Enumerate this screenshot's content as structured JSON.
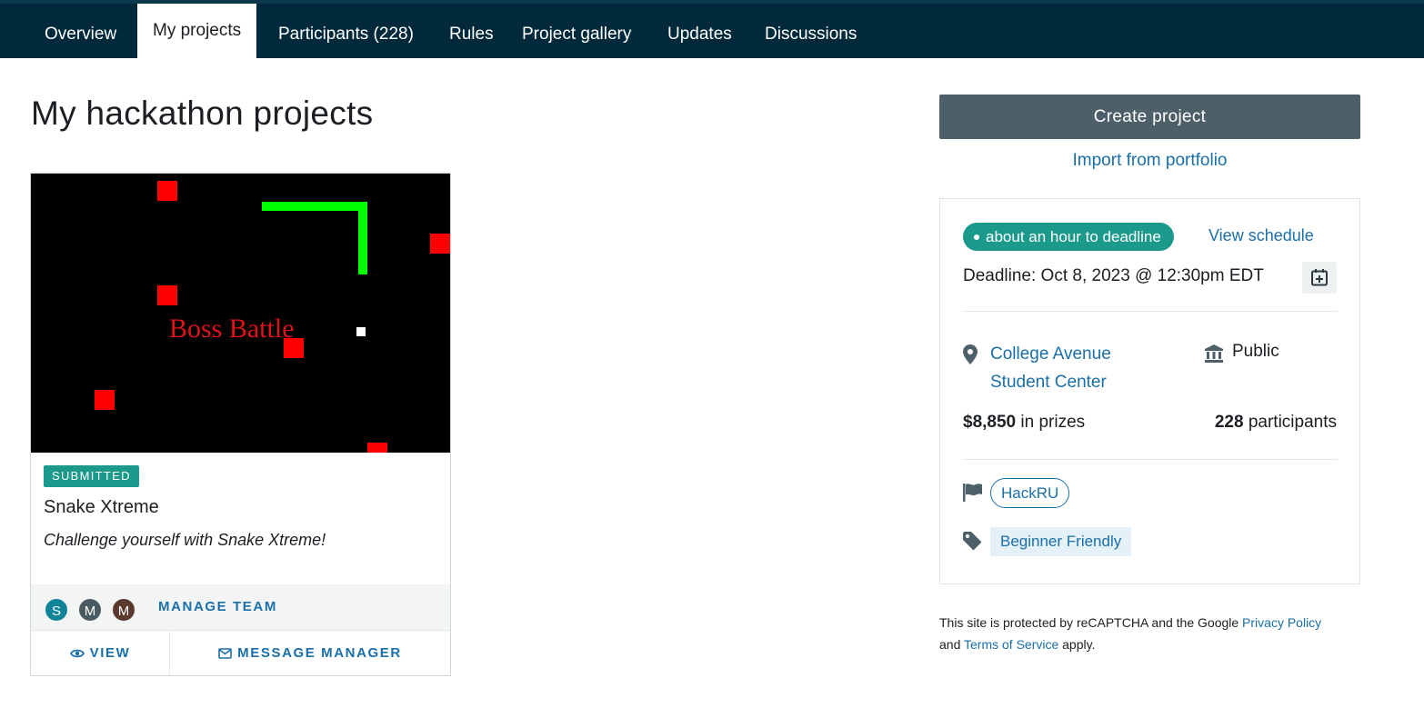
{
  "nav": {
    "tabs": [
      {
        "label": "Overview"
      },
      {
        "label": "My projects"
      },
      {
        "label": "Participants (228)"
      },
      {
        "label": "Rules"
      },
      {
        "label": "Project gallery"
      },
      {
        "label": "Updates"
      },
      {
        "label": "Discussions"
      }
    ],
    "active_tab": "My projects"
  },
  "page": {
    "title": "My hackathon projects"
  },
  "project": {
    "thumbnail_text": "Boss Battle",
    "status": "SUBMITTED",
    "name": "Snake Xtreme",
    "tagline": "Challenge yourself with Snake Xtreme!",
    "team": [
      {
        "initial": "S",
        "color": "#12849a"
      },
      {
        "initial": "M",
        "color": "#4a5a62"
      },
      {
        "initial": "M",
        "color": "#5a3a2e"
      }
    ],
    "manage_team_label": "MANAGE TEAM",
    "view_label": "VIEW",
    "message_label": "MESSAGE MANAGER"
  },
  "sidebar": {
    "create_label": "Create project",
    "import_label": "Import from portfolio",
    "time_left": "about an hour to deadline",
    "view_schedule": "View schedule",
    "deadline": "Deadline: Oct 8, 2023 @ 12:30pm EDT",
    "location_line1": "College Avenue",
    "location_line2": "Student Center",
    "visibility": "Public",
    "prize_amount": "$8,850",
    "prize_suffix": " in prizes",
    "participant_count": "228",
    "participant_suffix": " participants",
    "host": "HackRU",
    "theme": "Beginner Friendly"
  },
  "recaptcha": {
    "text1": "This site is protected by reCAPTCHA and the Google ",
    "privacy": "Privacy Policy",
    "text2": "and ",
    "terms": "Terms of Service",
    "text3": " apply."
  },
  "colors": {
    "nav_bg": "#002a3b",
    "accent_teal": "#1b9a8c",
    "link_blue": "#1a6fa8",
    "button_slate": "#4d5f68"
  }
}
